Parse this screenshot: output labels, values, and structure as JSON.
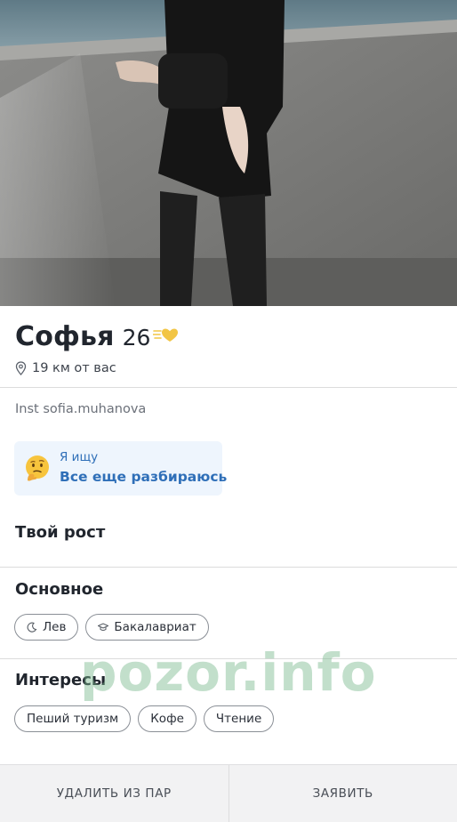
{
  "profile": {
    "name": "Софья",
    "age": "26",
    "distance": "19 км от вас",
    "bio": "Inst sofia.muhanova"
  },
  "looking_for": {
    "label": "Я ищу",
    "value": "Все еще разбираюсь",
    "icon": "thinking-face-icon"
  },
  "sections": {
    "height_title": "Твой рост",
    "basics_title": "Основное",
    "basics": [
      {
        "label": "Лев",
        "icon": "moon-icon"
      },
      {
        "label": "Бакалавриат",
        "icon": "graduation-cap-icon"
      }
    ],
    "interests_title": "Интересы",
    "interests": [
      "Пеший туризм",
      "Кофе",
      "Чтение"
    ]
  },
  "watermark": "pozor.info",
  "actions": {
    "remove_label": "УДАЛИТЬ ИЗ ПАР",
    "report_label": "ЗАЯВИТЬ"
  },
  "colors": {
    "accent_blue": "#2f6fb8",
    "looking_bg": "#eef5fd",
    "heart": "#f2c544"
  }
}
